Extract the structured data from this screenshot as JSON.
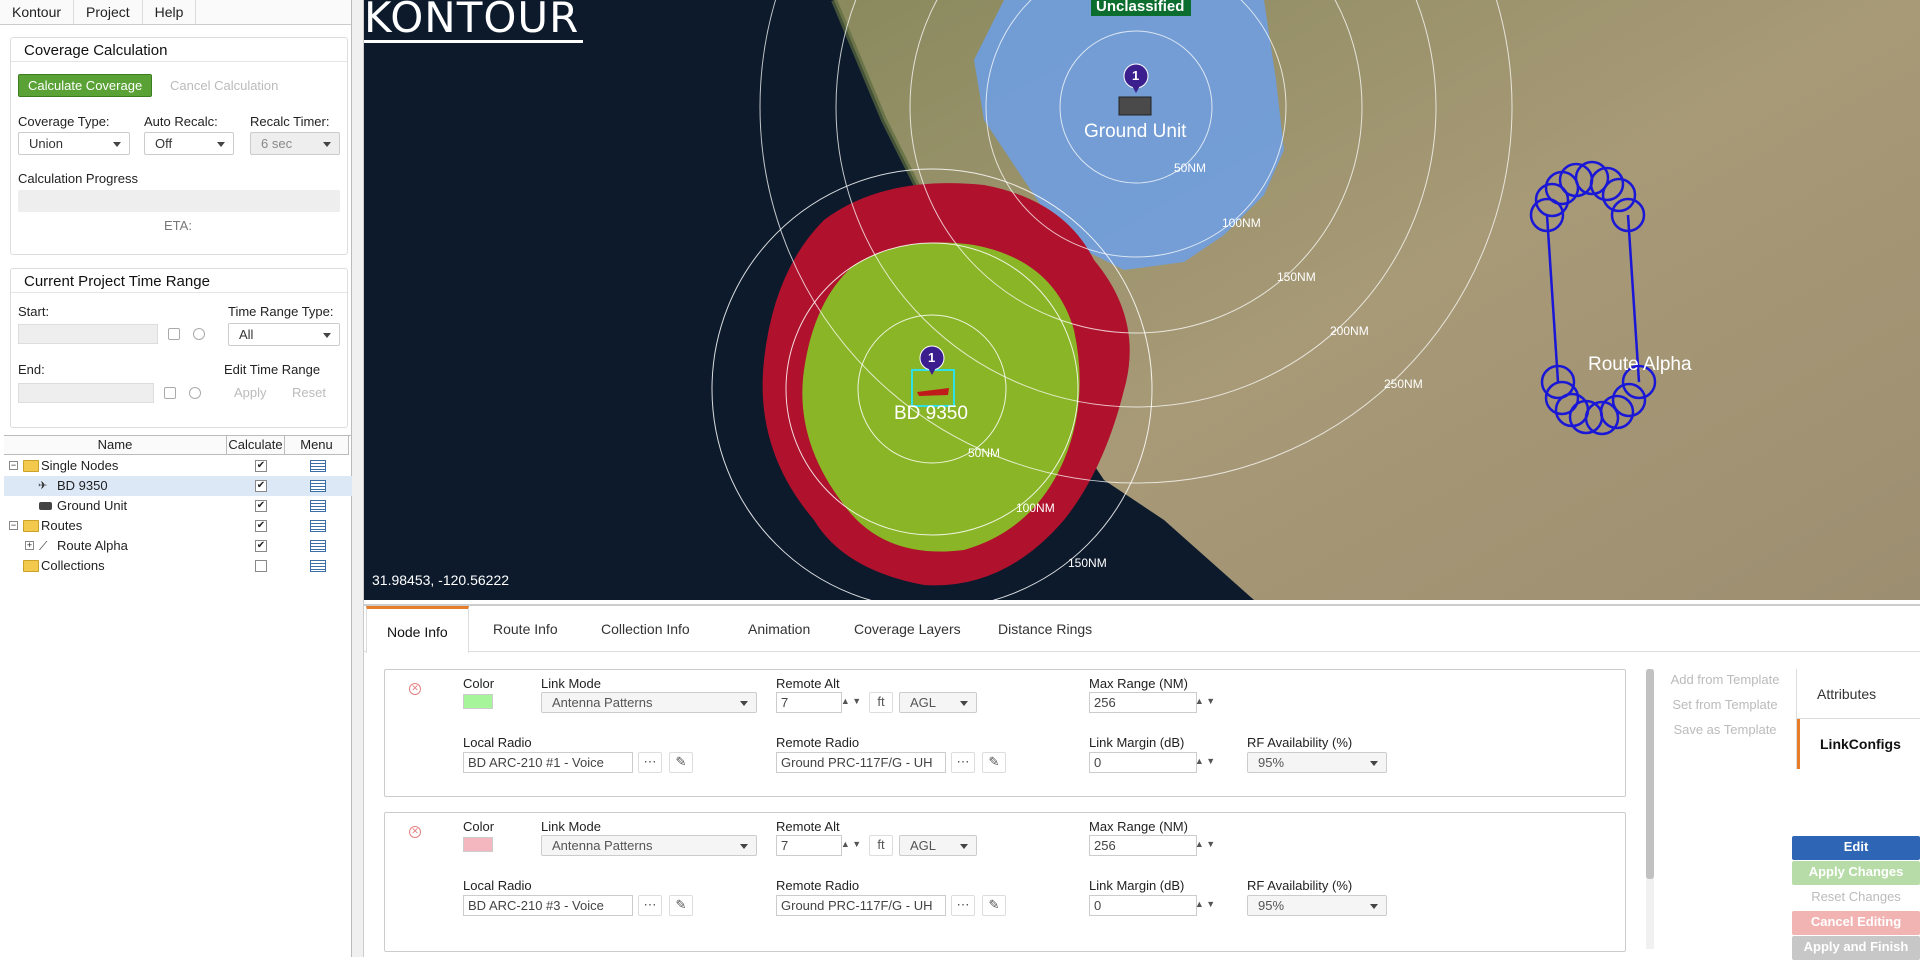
{
  "menubar": [
    "Kontour",
    "Project",
    "Help"
  ],
  "coverage": {
    "title": "Coverage Calculation",
    "calc_button": "Calculate Coverage",
    "cancel_button": "Cancel Calculation",
    "type_label": "Coverage Type:",
    "type_value": "Union",
    "auto_label": "Auto Recalc:",
    "auto_value": "Off",
    "timer_label": "Recalc Timer:",
    "timer_value": "6 sec",
    "progress_label": "Calculation Progress",
    "eta_label": "ETA:"
  },
  "time_range": {
    "title": "Current Project Time Range",
    "start_label": "Start:",
    "type_label": "Time Range Type:",
    "type_value": "All",
    "end_label": "End:",
    "edit_label": "Edit Time Range",
    "apply": "Apply",
    "reset": "Reset"
  },
  "tree": {
    "headers": [
      "Name",
      "Calculate",
      "Menu"
    ],
    "rows": [
      {
        "label": "Single Nodes",
        "checked": true
      },
      {
        "label": "BD 9350",
        "checked": true
      },
      {
        "label": "Ground Unit",
        "checked": true
      },
      {
        "label": "Routes",
        "checked": true
      },
      {
        "label": "Route Alpha",
        "checked": true
      },
      {
        "label": "Collections",
        "checked": false
      }
    ]
  },
  "map": {
    "logo": "KONTOUR",
    "classification": "Unclassified",
    "coords": "31.98453, -120.56222",
    "labels": {
      "bd": "BD 9350",
      "ground": "Ground Unit",
      "route": "Route Alpha",
      "marker_num": "1"
    },
    "rings_bd": [
      "50NM",
      "100NM",
      "150NM"
    ],
    "rings_ground": [
      "50NM",
      "100NM",
      "150NM",
      "200NM",
      "250NM"
    ]
  },
  "tabs": [
    "Node Info",
    "Route Info",
    "Collection Info",
    "Animation",
    "Coverage Layers",
    "Distance Rings"
  ],
  "link_cards": [
    {
      "color": "#a7f59a",
      "color_label": "Color",
      "link_mode_label": "Link Mode",
      "link_mode": "Antenna Patterns",
      "remote_alt_label": "Remote Alt",
      "remote_alt": "7",
      "alt_unit": "ft",
      "alt_ref": "AGL",
      "max_range_label": "Max Range (NM)",
      "max_range": "256",
      "local_radio_label": "Local Radio",
      "local_radio": "BD ARC-210 #1 - Voice",
      "remote_radio_label": "Remote Radio",
      "remote_radio": "Ground PRC-117F/G - UH",
      "link_margin_label": "Link Margin (dB)",
      "link_margin": "0",
      "rf_label": "RF Availability (%)",
      "rf": "95%"
    },
    {
      "color": "#f4b6bf",
      "color_label": "Color",
      "link_mode_label": "Link Mode",
      "link_mode": "Antenna Patterns",
      "remote_alt_label": "Remote Alt",
      "remote_alt": "7",
      "alt_unit": "ft",
      "alt_ref": "AGL",
      "max_range_label": "Max Range (NM)",
      "max_range": "256",
      "local_radio_label": "Local Radio",
      "local_radio": "BD ARC-210 #3 - Voice",
      "remote_radio_label": "Remote Radio",
      "remote_radio": "Ground PRC-117F/G - UH",
      "link_margin_label": "Link Margin (dB)",
      "link_margin": "0",
      "rf_label": "RF Availability (%)",
      "rf": "95%"
    }
  ],
  "template_buttons": [
    "Add from Template",
    "Set from Template",
    "Save as Template"
  ],
  "side_tabs": [
    "Attributes",
    "LinkConfigs"
  ],
  "edit_buttons": [
    "Edit",
    "Apply Changes",
    "Reset Changes",
    "Cancel Editing",
    "Apply and Finish"
  ],
  "colors": {
    "accent_tab": "#e57d2b",
    "calc_green": "#5aa236",
    "coverage_red": "#b0112c",
    "coverage_green": "#8ab526",
    "coverage_blue": "#6f9fe0",
    "route_blue": "#1a17d6",
    "edit_blue": "#2e66b5"
  }
}
